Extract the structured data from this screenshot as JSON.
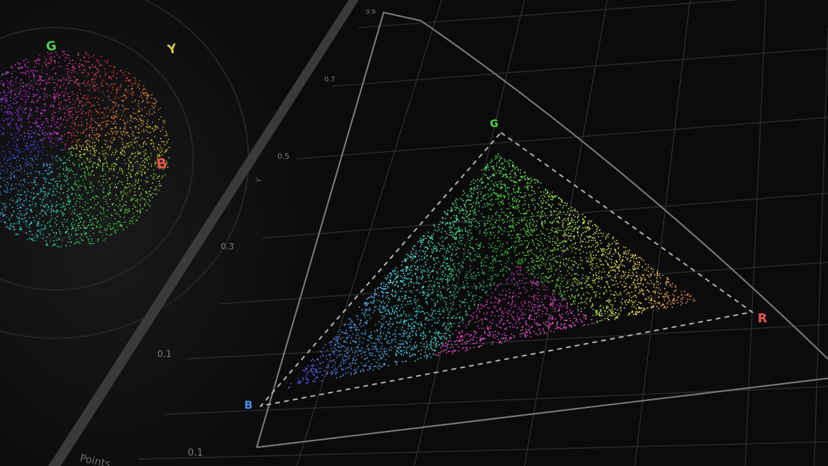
{
  "chromaticity_panel": {
    "axis_label": "Y",
    "tick_labels": [
      "0.9",
      "0.7",
      "0.5",
      "0.3",
      "0.1",
      "0.1"
    ],
    "primaries": {
      "red": {
        "label": "R",
        "color": "#e8574f"
      },
      "green": {
        "label": "G",
        "color": "#4fd44a"
      },
      "blue": {
        "label": "B",
        "color": "#4a90e8"
      }
    },
    "locus_color": "#7a7a7a",
    "grid_color": "#2a2b2d",
    "triangle_line_color": "#b9b9b9"
  },
  "vectorscope_panel": {
    "marker_labels": {
      "blue": {
        "label": "B",
        "color": "#e8574f"
      },
      "yellow": {
        "label": "Y",
        "color": "#d4c44a"
      },
      "green": {
        "label": "G",
        "color": "#4fd44a"
      }
    },
    "footer_text": "Points"
  },
  "divider_color": "#3a3a3c"
}
